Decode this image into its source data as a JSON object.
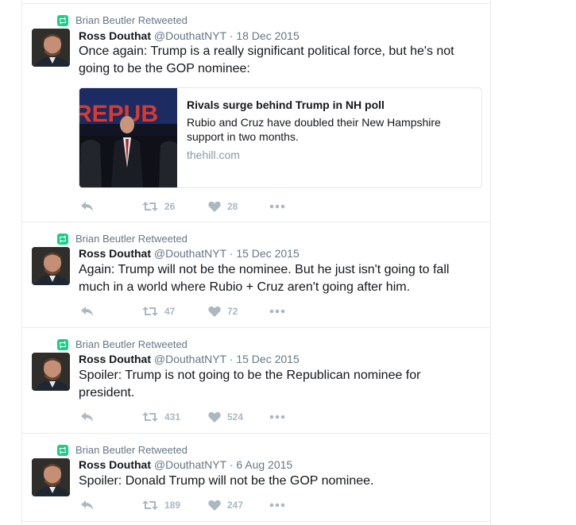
{
  "tweets": [
    {
      "retweeted_by": "Brian Beutler Retweeted",
      "name": "Ross Douthat",
      "handle": "@DouthatNYT",
      "separator": "·",
      "date": "18 Dec 2015",
      "text": "Once again: Trump is a really significant political force, but he's not going to be the GOP nominee:",
      "card": {
        "title": "Rivals surge behind Trump in NH poll",
        "description": "Rubio and Cruz have doubled their New Hampshire support in two months.",
        "domain": "thehill.com",
        "image_text": "REPUB"
      },
      "retweets": "26",
      "likes": "28"
    },
    {
      "retweeted_by": "Brian Beutler Retweeted",
      "name": "Ross Douthat",
      "handle": "@DouthatNYT",
      "separator": "·",
      "date": "15 Dec 2015",
      "text": "Again: Trump will not be the nominee. But he just isn't going to fall much in a world where Rubio + Cruz aren't going after him.",
      "retweets": "47",
      "likes": "72"
    },
    {
      "retweeted_by": "Brian Beutler Retweeted",
      "name": "Ross Douthat",
      "handle": "@DouthatNYT",
      "separator": "·",
      "date": "15 Dec 2015",
      "text": "Spoiler: Trump is not going to be the Republican nominee for president.",
      "retweets": "431",
      "likes": "524"
    },
    {
      "retweeted_by": "Brian Beutler Retweeted",
      "name": "Ross Douthat",
      "handle": "@DouthatNYT",
      "separator": "·",
      "date": "6 Aug 2015",
      "text": "Spoiler: Donald Trump will not be the GOP nominee.",
      "retweets": "189",
      "likes": "247"
    }
  ],
  "icons": {
    "retweet_badge": "retweet-icon",
    "reply": "reply-icon",
    "retweet": "retweet-icon",
    "like": "heart-icon",
    "more": "more-icon"
  },
  "colors": {
    "retweet_green": "#19cf86",
    "muted": "#657786",
    "action_gray": "#aab8c2",
    "border": "#e6ecf0",
    "text": "#14171a"
  }
}
